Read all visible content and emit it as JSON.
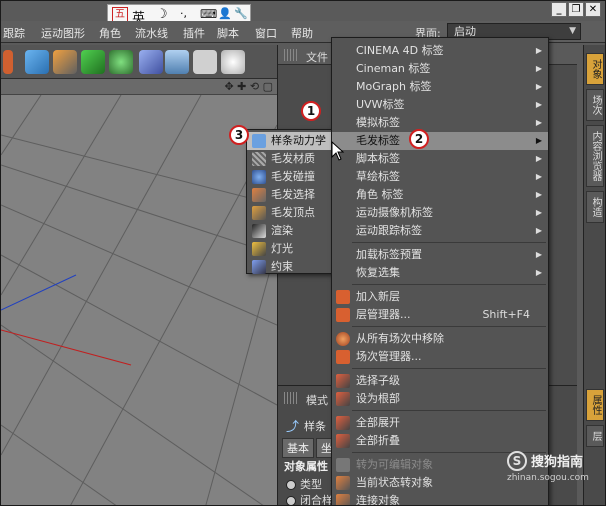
{
  "menubar": {
    "items": [
      "跟踪",
      "运动图形",
      "角色",
      "流水线",
      "插件",
      "脚本",
      "窗口",
      "帮助"
    ],
    "layout_label": "界面:",
    "layout_value": "启动"
  },
  "ime": {
    "wu": "五",
    "mode": "英",
    "moon": "☽",
    "dots": "·,",
    "kbd": "⌨",
    "person": "👤",
    "wrench": "🔧"
  },
  "objmgr": {
    "file_label": "文件"
  },
  "attrmgr": {
    "mode_label": "模式",
    "obj_name": "样条",
    "tabs": [
      "基本",
      "坐"
    ],
    "props_label": "对象属性",
    "row1": "类型",
    "row2": "闭合样"
  },
  "vtabs": [
    "对象",
    "场次",
    "内容浏览器",
    "构造",
    "属性",
    "层"
  ],
  "context_menu": {
    "items": [
      {
        "label": "CINEMA 4D 标签",
        "sub": true
      },
      {
        "label": "Cineman 标签",
        "sub": true
      },
      {
        "label": "MoGraph 标签",
        "sub": true
      },
      {
        "label": "UVW标签",
        "sub": true
      },
      {
        "label": "模拟标签",
        "sub": true
      },
      {
        "label": "毛发标签",
        "sub": true,
        "highlight": true
      },
      {
        "label": "脚本标签",
        "sub": true
      },
      {
        "label": "草绘标签",
        "sub": true
      },
      {
        "label": "角色 标签",
        "sub": true
      },
      {
        "label": "运动摄像机标签",
        "sub": true
      },
      {
        "label": "运动跟踪标签",
        "sub": true
      },
      {
        "label": "加载标签预置",
        "sub": true
      },
      {
        "label": "恢复选集",
        "sub": true
      },
      {
        "label": "加入新层"
      },
      {
        "label": "层管理器...",
        "shortcut": "Shift+F4"
      },
      {
        "label": "从所有场次中移除"
      },
      {
        "label": "场次管理器..."
      },
      {
        "label": "选择子级"
      },
      {
        "label": "设为根部"
      },
      {
        "label": "全部展开"
      },
      {
        "label": "全部折叠"
      },
      {
        "label": "转为可编辑对象",
        "dim": true
      },
      {
        "label": "当前状态转对象"
      },
      {
        "label": "连接对象"
      }
    ]
  },
  "hair_submenu": {
    "items": [
      "样条动力学",
      "毛发材质",
      "毛发碰撞",
      "毛发选择",
      "毛发顶点",
      "渲染",
      "灯光",
      "约束"
    ]
  },
  "badges": [
    "1",
    "2",
    "3"
  ],
  "watermark": {
    "logo": "S",
    "name": "搜狗指南",
    "url": "zhinan.sogou.com"
  },
  "colors": {
    "highlight": "#8c8c8c",
    "badge_border": "#d02020",
    "active_tab": "#d8a23a"
  }
}
